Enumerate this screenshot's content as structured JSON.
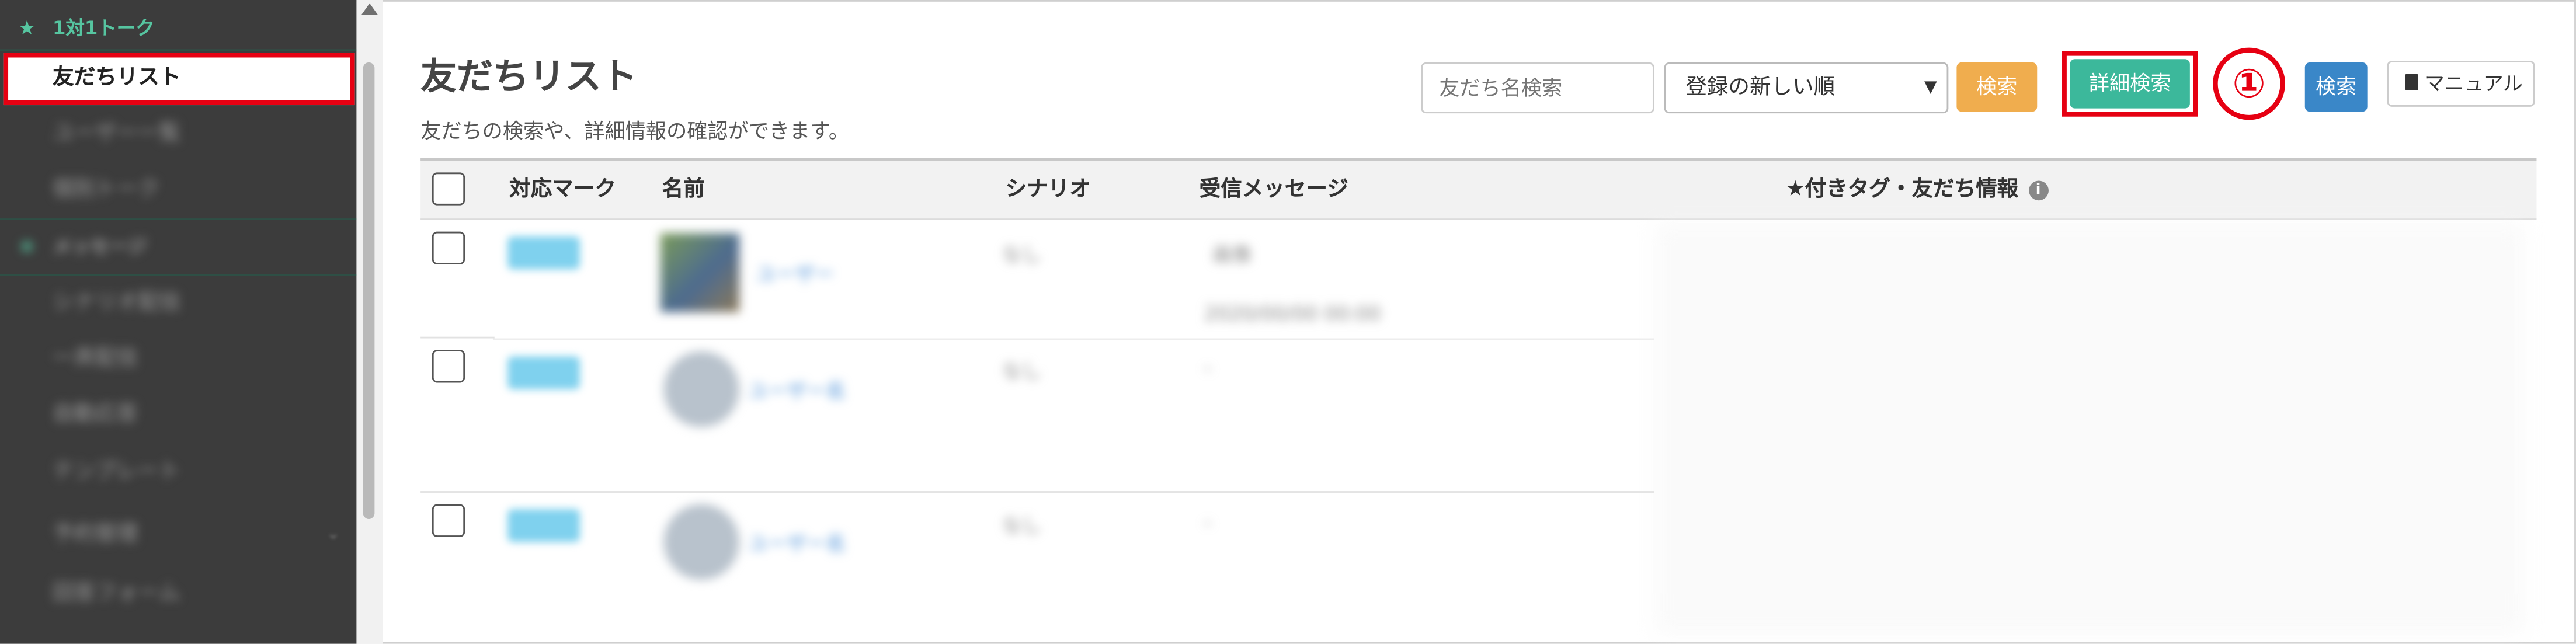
{
  "sidebar": {
    "section_top": "1対1トーク",
    "active_item": "友だちリスト",
    "blurred_items": [
      "ユーザー一覧",
      "個別トーク",
      "メッセージ",
      "シナリオ配信",
      "一斉配信",
      "自動応答",
      "テンプレート",
      "予約管理",
      "回答フォーム"
    ]
  },
  "header": {
    "title": "友だちリスト",
    "subtitle": "友だちの検索や、詳細情報の確認ができます。"
  },
  "search": {
    "placeholder": "友だち名検索",
    "sort_selected": "登録の新しい順",
    "search_label": "検索",
    "advanced_search_label": "詳細検索",
    "step_marker": "①",
    "search2_label": "検索",
    "manual_label": "マニュアル"
  },
  "table": {
    "columns": [
      "対応マーク",
      "名前",
      "シナリオ",
      "受信メッセージ",
      "★付きタグ・友だち情報"
    ],
    "rows": [
      {
        "mark": "対応中",
        "name": "ユーザー",
        "scenario": "なし",
        "message": "画像",
        "date": "2020/00/00 00:00"
      },
      {
        "mark": "対応中",
        "name": "ユーザー名",
        "scenario": "なし",
        "message": "-",
        "date": ""
      },
      {
        "mark": "対応中",
        "name": "ユーザー名",
        "scenario": "なし",
        "message": "-",
        "date": ""
      }
    ]
  },
  "colors": {
    "sidebar_bg": "#3c3c3c",
    "accent_green": "#3cb89b",
    "highlight_red": "#e60012",
    "button_orange": "#f0ad4e",
    "button_blue": "#3a87c8"
  }
}
